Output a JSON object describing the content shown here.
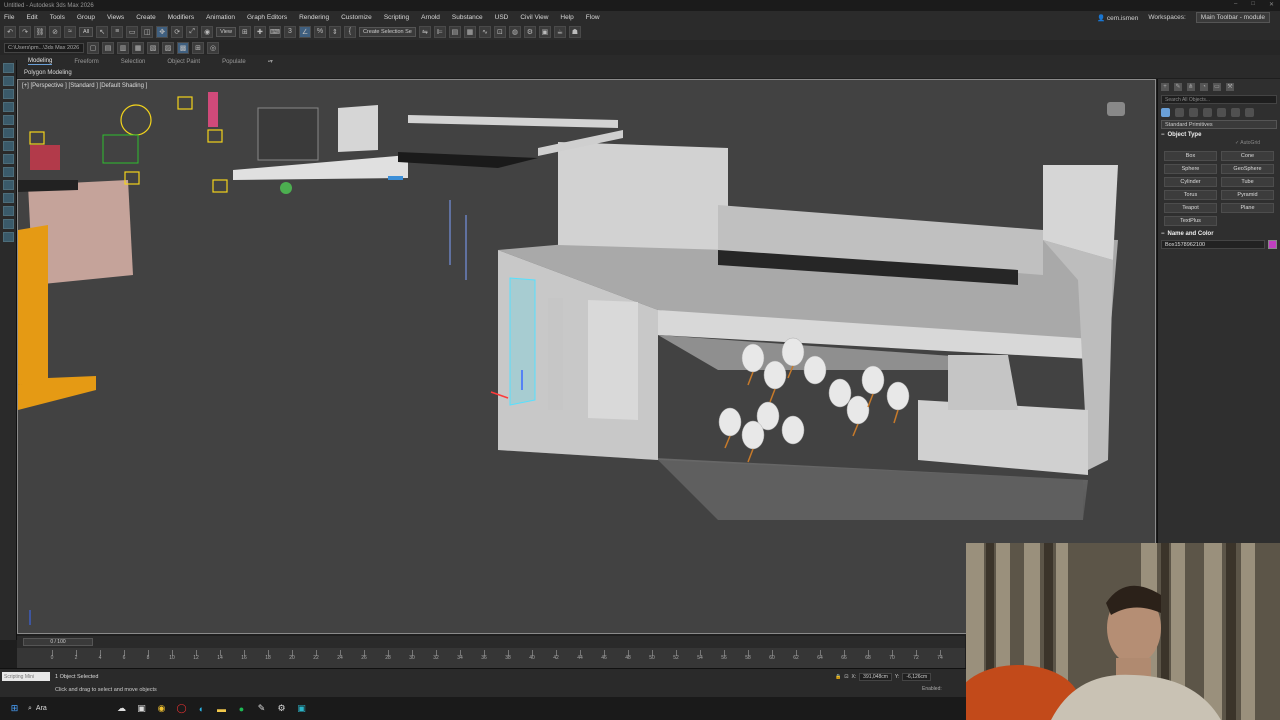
{
  "window": {
    "title": "Untitled - Autodesk 3ds Max 2026"
  },
  "menu": [
    "File",
    "Edit",
    "Tools",
    "Group",
    "Views",
    "Create",
    "Modifiers",
    "Animation",
    "Graph Editors",
    "Rendering",
    "Customize",
    "Scripting",
    "Arnold",
    "Substance",
    "USD",
    "Civil View",
    "Help",
    "Flow"
  ],
  "user": {
    "name": "cem.ismen",
    "workspaces_label": "Workspaces:",
    "workspace": "Main Toolbar - module"
  },
  "toolbar": {
    "filter": "All",
    "ref_coord": "View",
    "selection_set": "Create Selection Se"
  },
  "project_path": "C:\\Users\\pm...\\3ds Max 2026",
  "ribbon": {
    "tabs": [
      "Modeling",
      "Freeform",
      "Selection",
      "Object Paint",
      "Populate"
    ],
    "active": "Modeling",
    "sub": "Polygon Modeling"
  },
  "viewport": {
    "label": "[+] [Perspective ] [Standard ] [Default Shading ]"
  },
  "command_panel": {
    "search": "Search All Objects...",
    "category": "Standard Primitives",
    "object_type_title": "Object Type",
    "autogrid": "AutoGrid",
    "primitives": [
      "Box",
      "Cone",
      "Sphere",
      "GeoSphere",
      "Cylinder",
      "Tube",
      "Torus",
      "Pyramid",
      "Teapot",
      "Plane",
      "TextPlus"
    ],
    "name_color_title": "Name and Color",
    "object_name": "Box1578962100",
    "object_color": "#c040c0"
  },
  "timeline": {
    "frame_display": "0 / 100",
    "ticks": [
      "0",
      "2",
      "4",
      "6",
      "8",
      "10",
      "12",
      "14",
      "16",
      "18",
      "20",
      "22",
      "24",
      "26",
      "28",
      "30",
      "32",
      "34",
      "36",
      "38",
      "40",
      "42",
      "44",
      "46",
      "48",
      "50",
      "52",
      "54",
      "56",
      "58",
      "60",
      "62",
      "64",
      "66",
      "68",
      "70",
      "72",
      "74",
      "76"
    ]
  },
  "status": {
    "maxscript": "Scripting Mini",
    "selected": "1 Object Selected",
    "prompt": "Click and drag to select and move objects",
    "x": "391,048cm",
    "y": "-6,126cm",
    "enabled": "Enabled:"
  },
  "taskbar": {
    "search": "Ara"
  }
}
